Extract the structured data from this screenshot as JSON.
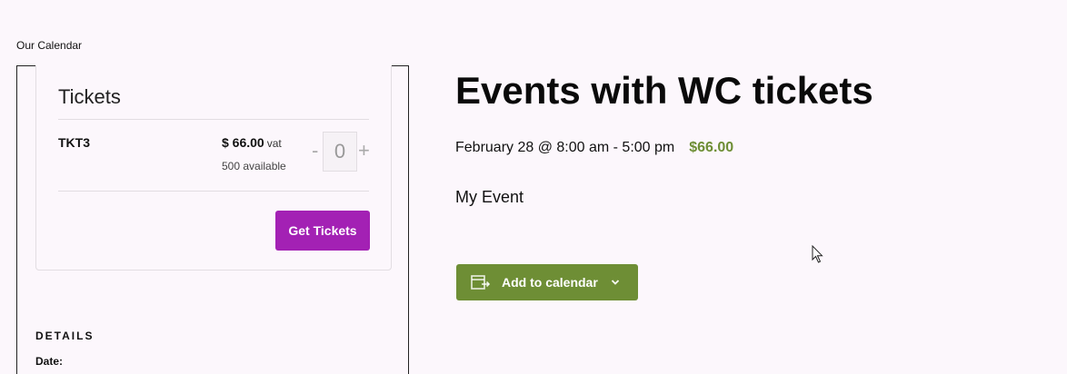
{
  "breadcrumb": "Our Calendar",
  "tickets": {
    "title": "Tickets",
    "ticket": {
      "name": "TKT3",
      "price": "$ 66.00",
      "vat": "vat",
      "available": "500 available",
      "qty_minus": "-",
      "qty_plus": "+",
      "qty_value": "0"
    },
    "get_tickets_label": "Get Tickets"
  },
  "details": {
    "heading": "DETAILS",
    "date_label": "Date:"
  },
  "event": {
    "title": "Events with WC tickets",
    "datetime": "February 28 @ 8:00 am - 5:00 pm",
    "cost": "$66.00",
    "description": "My Event",
    "add_to_calendar_label": "Add to calendar"
  },
  "colors": {
    "accent_purple": "#a321b4",
    "accent_green": "#6e8e35",
    "background": "#fcf7fc"
  },
  "icons": {
    "calendar_export": "calendar-export-icon",
    "chevron": "chevron-down-icon",
    "cursor": "mouse-pointer-icon"
  }
}
